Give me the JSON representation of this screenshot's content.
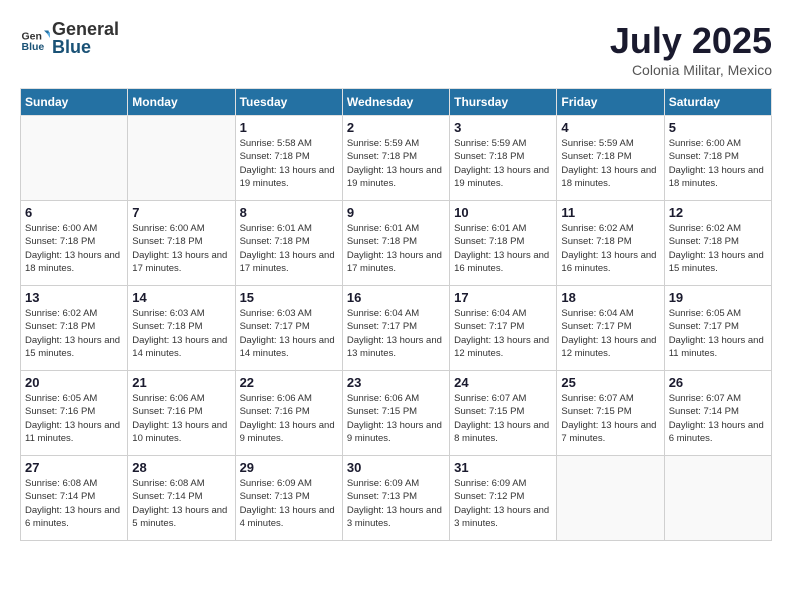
{
  "logo": {
    "general": "General",
    "blue": "Blue"
  },
  "title": "July 2025",
  "subtitle": "Colonia Militar, Mexico",
  "days_of_week": [
    "Sunday",
    "Monday",
    "Tuesday",
    "Wednesday",
    "Thursday",
    "Friday",
    "Saturday"
  ],
  "weeks": [
    [
      {
        "day": "",
        "info": ""
      },
      {
        "day": "",
        "info": ""
      },
      {
        "day": "1",
        "sunrise": "5:58 AM",
        "sunset": "7:18 PM",
        "daylight": "13 hours and 19 minutes."
      },
      {
        "day": "2",
        "sunrise": "5:59 AM",
        "sunset": "7:18 PM",
        "daylight": "13 hours and 19 minutes."
      },
      {
        "day": "3",
        "sunrise": "5:59 AM",
        "sunset": "7:18 PM",
        "daylight": "13 hours and 19 minutes."
      },
      {
        "day": "4",
        "sunrise": "5:59 AM",
        "sunset": "7:18 PM",
        "daylight": "13 hours and 18 minutes."
      },
      {
        "day": "5",
        "sunrise": "6:00 AM",
        "sunset": "7:18 PM",
        "daylight": "13 hours and 18 minutes."
      }
    ],
    [
      {
        "day": "6",
        "sunrise": "6:00 AM",
        "sunset": "7:18 PM",
        "daylight": "13 hours and 18 minutes."
      },
      {
        "day": "7",
        "sunrise": "6:00 AM",
        "sunset": "7:18 PM",
        "daylight": "13 hours and 17 minutes."
      },
      {
        "day": "8",
        "sunrise": "6:01 AM",
        "sunset": "7:18 PM",
        "daylight": "13 hours and 17 minutes."
      },
      {
        "day": "9",
        "sunrise": "6:01 AM",
        "sunset": "7:18 PM",
        "daylight": "13 hours and 17 minutes."
      },
      {
        "day": "10",
        "sunrise": "6:01 AM",
        "sunset": "7:18 PM",
        "daylight": "13 hours and 16 minutes."
      },
      {
        "day": "11",
        "sunrise": "6:02 AM",
        "sunset": "7:18 PM",
        "daylight": "13 hours and 16 minutes."
      },
      {
        "day": "12",
        "sunrise": "6:02 AM",
        "sunset": "7:18 PM",
        "daylight": "13 hours and 15 minutes."
      }
    ],
    [
      {
        "day": "13",
        "sunrise": "6:02 AM",
        "sunset": "7:18 PM",
        "daylight": "13 hours and 15 minutes."
      },
      {
        "day": "14",
        "sunrise": "6:03 AM",
        "sunset": "7:18 PM",
        "daylight": "13 hours and 14 minutes."
      },
      {
        "day": "15",
        "sunrise": "6:03 AM",
        "sunset": "7:17 PM",
        "daylight": "13 hours and 14 minutes."
      },
      {
        "day": "16",
        "sunrise": "6:04 AM",
        "sunset": "7:17 PM",
        "daylight": "13 hours and 13 minutes."
      },
      {
        "day": "17",
        "sunrise": "6:04 AM",
        "sunset": "7:17 PM",
        "daylight": "13 hours and 12 minutes."
      },
      {
        "day": "18",
        "sunrise": "6:04 AM",
        "sunset": "7:17 PM",
        "daylight": "13 hours and 12 minutes."
      },
      {
        "day": "19",
        "sunrise": "6:05 AM",
        "sunset": "7:17 PM",
        "daylight": "13 hours and 11 minutes."
      }
    ],
    [
      {
        "day": "20",
        "sunrise": "6:05 AM",
        "sunset": "7:16 PM",
        "daylight": "13 hours and 11 minutes."
      },
      {
        "day": "21",
        "sunrise": "6:06 AM",
        "sunset": "7:16 PM",
        "daylight": "13 hours and 10 minutes."
      },
      {
        "day": "22",
        "sunrise": "6:06 AM",
        "sunset": "7:16 PM",
        "daylight": "13 hours and 9 minutes."
      },
      {
        "day": "23",
        "sunrise": "6:06 AM",
        "sunset": "7:15 PM",
        "daylight": "13 hours and 9 minutes."
      },
      {
        "day": "24",
        "sunrise": "6:07 AM",
        "sunset": "7:15 PM",
        "daylight": "13 hours and 8 minutes."
      },
      {
        "day": "25",
        "sunrise": "6:07 AM",
        "sunset": "7:15 PM",
        "daylight": "13 hours and 7 minutes."
      },
      {
        "day": "26",
        "sunrise": "6:07 AM",
        "sunset": "7:14 PM",
        "daylight": "13 hours and 6 minutes."
      }
    ],
    [
      {
        "day": "27",
        "sunrise": "6:08 AM",
        "sunset": "7:14 PM",
        "daylight": "13 hours and 6 minutes."
      },
      {
        "day": "28",
        "sunrise": "6:08 AM",
        "sunset": "7:14 PM",
        "daylight": "13 hours and 5 minutes."
      },
      {
        "day": "29",
        "sunrise": "6:09 AM",
        "sunset": "7:13 PM",
        "daylight": "13 hours and 4 minutes."
      },
      {
        "day": "30",
        "sunrise": "6:09 AM",
        "sunset": "7:13 PM",
        "daylight": "13 hours and 3 minutes."
      },
      {
        "day": "31",
        "sunrise": "6:09 AM",
        "sunset": "7:12 PM",
        "daylight": "13 hours and 3 minutes."
      },
      {
        "day": "",
        "info": ""
      },
      {
        "day": "",
        "info": ""
      }
    ]
  ],
  "labels": {
    "sunrise": "Sunrise:",
    "sunset": "Sunset:",
    "daylight": "Daylight:"
  }
}
